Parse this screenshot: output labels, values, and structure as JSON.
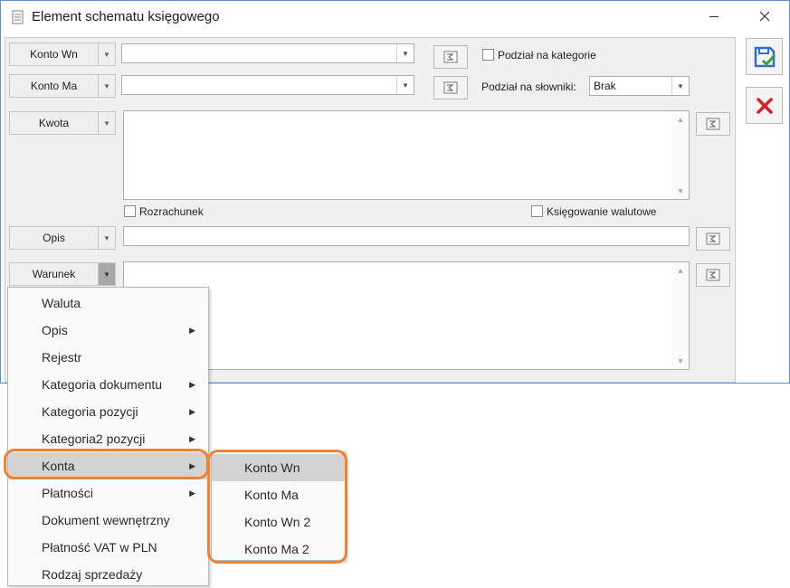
{
  "window": {
    "title": "Element schematu księgowego",
    "minimize_icon": "minimize-icon",
    "close_icon": "close-icon",
    "save_icon": "save-icon",
    "cancel_icon": "cancel-icon",
    "document_icon": "document-icon"
  },
  "form": {
    "konto_wn_label": "Konto Wn",
    "konto_ma_label": "Konto Ma",
    "kwota_label": "Kwota",
    "opis_label": "Opis",
    "warunek_label": "Warunek",
    "konto_wn_value": "",
    "konto_ma_value": "",
    "kwota_value": "",
    "opis_value": "",
    "warunek_value": "",
    "podzial_kategorie_label": "Podział na kategorie",
    "podzial_slowniki_label": "Podział na słowniki:",
    "podzial_slowniki_value": "Brak",
    "rozrachunek_label": "Rozrachunek",
    "ksiegowanie_walutowe_label": "Księgowanie walutowe"
  },
  "context_menu": {
    "items": [
      {
        "label": "Waluta",
        "submenu": false
      },
      {
        "label": "Opis",
        "submenu": true
      },
      {
        "label": "Rejestr",
        "submenu": false
      },
      {
        "label": "Kategoria dokumentu",
        "submenu": true
      },
      {
        "label": "Kategoria pozycji",
        "submenu": true
      },
      {
        "label": "Kategoria2 pozycji",
        "submenu": true
      },
      {
        "label": "Konta",
        "submenu": true,
        "highlighted": true
      },
      {
        "label": "Płatności",
        "submenu": true
      },
      {
        "label": "Dokument wewnętrzny",
        "submenu": false
      },
      {
        "label": "Płatność VAT w PLN",
        "submenu": false
      },
      {
        "label": "Rodzaj sprzedaży",
        "submenu": false
      }
    ]
  },
  "submenu": {
    "items": [
      {
        "label": "Konto Wn",
        "highlighted": true
      },
      {
        "label": "Konto Ma"
      },
      {
        "label": "Konto Wn 2"
      },
      {
        "label": "Konto Ma 2"
      }
    ]
  },
  "colors": {
    "window_border": "#5b8fd6",
    "highlight_ring": "#f08232",
    "save_blue": "#2f6fd0",
    "save_green": "#3aa335",
    "cancel_red": "#d91f26"
  }
}
